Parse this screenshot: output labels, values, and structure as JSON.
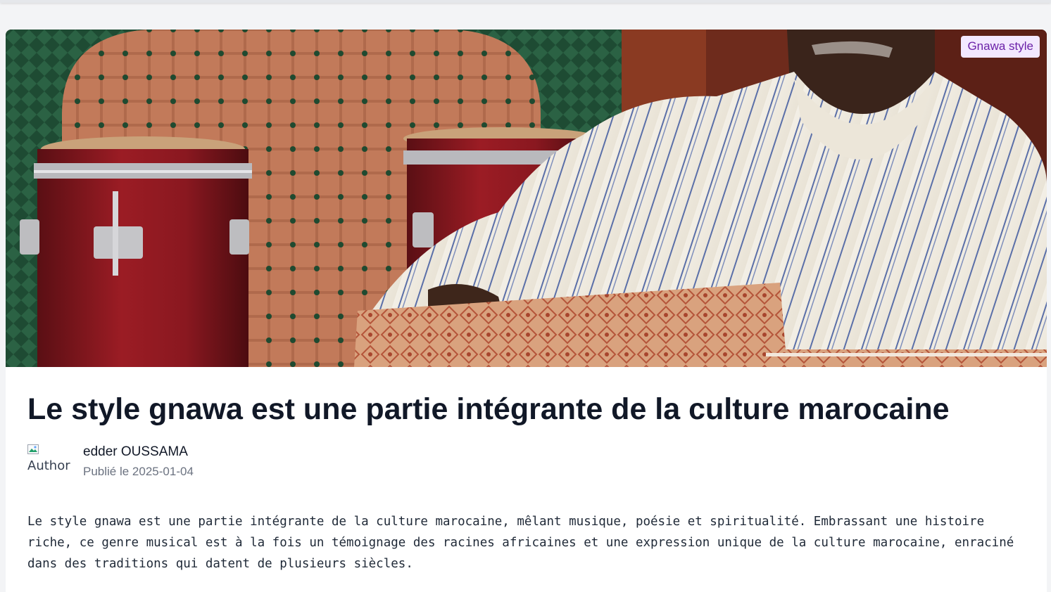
{
  "article": {
    "category_badge": "Gnawa style",
    "title": "Le style gnawa est une partie intégrante de la culture marocaine",
    "author_name": "edder OUSSAMA",
    "author_avatar_alt": "Author",
    "published": "Publié le 2025-01-04",
    "body": "Le style gnawa est une partie intégrante de la culture marocaine, mêlant musique, poésie et spiritualité. Embrassant une histoire riche, ce genre musical est à la fois un témoignage des racines africaines et une expression unique de la culture marocaine, enraciné dans des traditions qui datent de plusieurs siècles."
  },
  "icons": {
    "hero": "photo-image",
    "avatar": "broken-image-icon"
  },
  "colors": {
    "badge_bg": "#f3e8ff",
    "badge_text": "#6b21a8",
    "title": "#111827",
    "muted": "#6b7280"
  }
}
